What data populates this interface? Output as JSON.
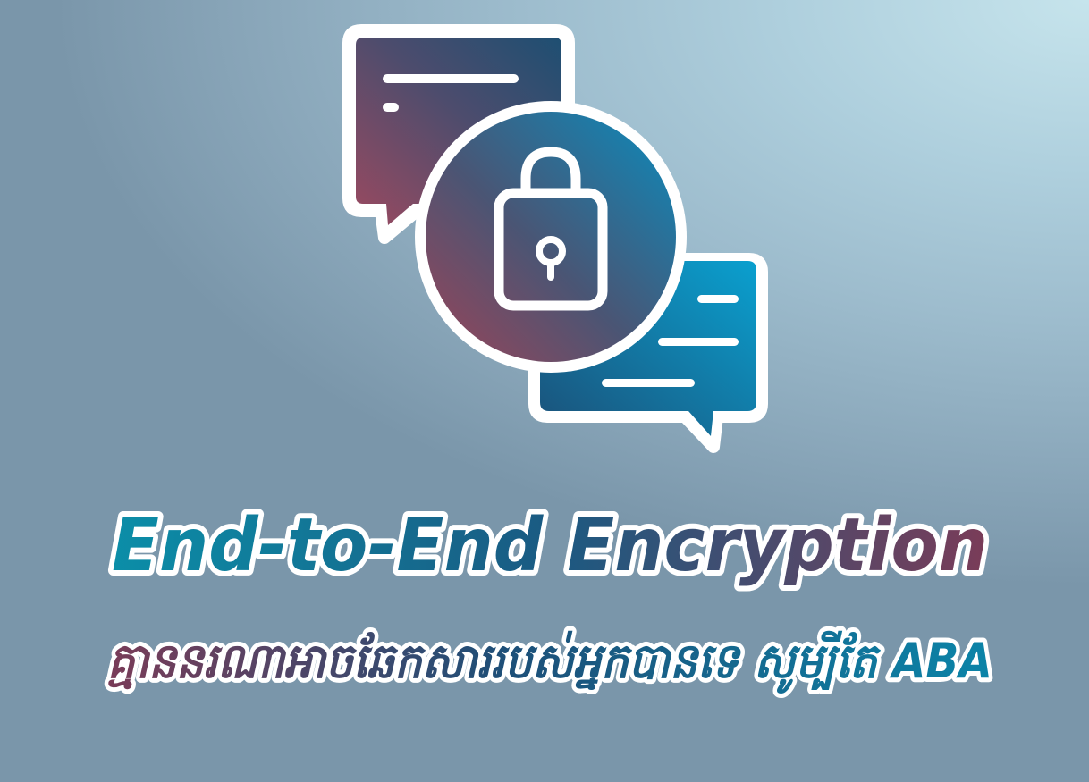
{
  "headline": "End-to-End Encryption",
  "tagline": "គ្មាននរណាអាចឆែកសាររបស់អ្នកបានទេ សូម្បីតែ ABA",
  "icons": {
    "left_bubble": "chat-bubble-icon",
    "right_bubble": "chat-bubble-icon",
    "center": "padlock-icon"
  },
  "colors": {
    "teal": "#0c8fa8",
    "navy": "#1b4f72",
    "maroon": "#8a3e55",
    "outline": "#ffffff"
  }
}
